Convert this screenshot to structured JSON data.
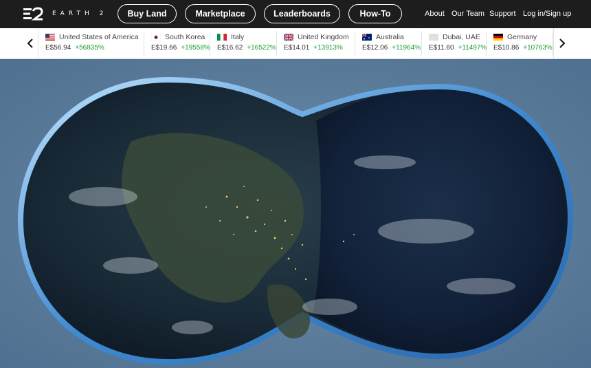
{
  "brand": {
    "word": "EARTH 2"
  },
  "nav": {
    "buttons": [
      {
        "label": "Buy Land"
      },
      {
        "label": "Marketplace"
      },
      {
        "label": "Leaderboards"
      },
      {
        "label": "How-To"
      }
    ],
    "links": [
      {
        "label": "About"
      },
      {
        "label": "Our Team"
      },
      {
        "label": "Support"
      },
      {
        "label": "Log in/Sign up"
      }
    ]
  },
  "ticker": {
    "items": [
      {
        "country": "United States of America",
        "price": "E$56.94",
        "change": "+56835%",
        "flag": "us-flag"
      },
      {
        "country": "South Korea",
        "price": "E$19.66",
        "change": "+19558%",
        "flag": "kr-flag"
      },
      {
        "country": "Italy",
        "price": "E$16.62",
        "change": "+16522%",
        "flag": "it-flag"
      },
      {
        "country": "United Kingdom",
        "price": "E$14.01",
        "change": "+13913%",
        "flag": "uk-flag"
      },
      {
        "country": "Australia",
        "price": "E$12.06",
        "change": "+11964%",
        "flag": "au-flag"
      },
      {
        "country": "Dubai, UAE",
        "price": "E$11.60",
        "change": "+11497%",
        "flag": "ae-flag"
      },
      {
        "country": "Germany",
        "price": "E$10.86",
        "change": "+10763%",
        "flag": "de-flag"
      }
    ]
  },
  "colors": {
    "gain": "#1a9e2e",
    "topbar": "#1d1d1d"
  }
}
